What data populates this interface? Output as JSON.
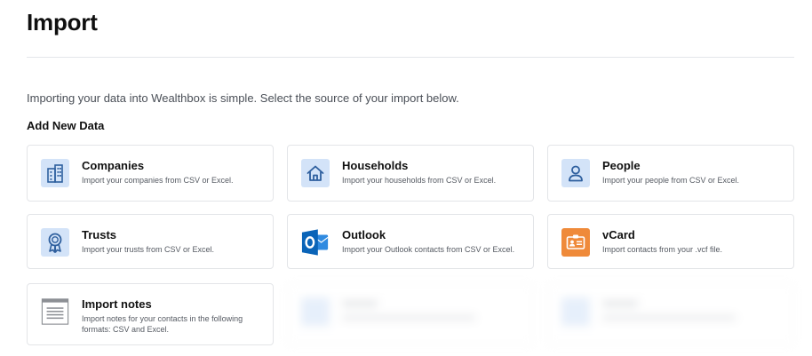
{
  "page": {
    "title": "Import",
    "intro": "Importing your data into Wealthbox is simple. Select the source of your import below.",
    "section_title": "Add New Data"
  },
  "cards": {
    "companies": {
      "title": "Companies",
      "desc": "Import your companies from CSV or Excel.",
      "icon": "building-icon"
    },
    "households": {
      "title": "Households",
      "desc": "Import your households from CSV or Excel.",
      "icon": "house-icon"
    },
    "people": {
      "title": "People",
      "desc": "Import your people from CSV or Excel.",
      "icon": "person-icon"
    },
    "trusts": {
      "title": "Trusts",
      "desc": "Import your trusts from CSV or Excel.",
      "icon": "ribbon-icon"
    },
    "outlook": {
      "title": "Outlook",
      "desc": "Import your Outlook contacts from CSV or Excel.",
      "icon": "outlook-icon"
    },
    "vcard": {
      "title": "vCard",
      "desc": "Import contacts from your .vcf file.",
      "icon": "contact-card-icon"
    },
    "notes": {
      "title": "Import notes",
      "desc": "Import notes for your contacts in the following formats: CSV and Excel.",
      "icon": "notes-icon"
    }
  },
  "colors": {
    "icon_blue_bg": "#d3e3f8",
    "icon_blue_fg": "#2e5f9e",
    "outlook_blue": "#0a64b8",
    "vcard_orange": "#ef8a3a"
  }
}
